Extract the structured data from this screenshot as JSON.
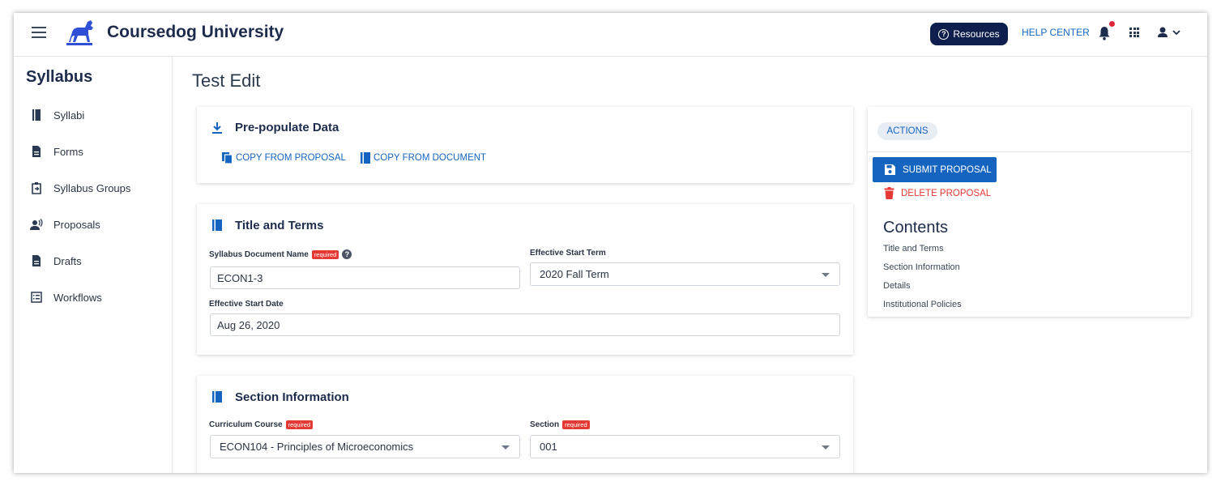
{
  "header": {
    "brand": "Coursedog University",
    "resources_label": "Resources",
    "help_center_label": "HELP CENTER"
  },
  "sidebar": {
    "title": "Syllabus",
    "items": [
      {
        "label": "Syllabi",
        "icon": "book-icon"
      },
      {
        "label": "Forms",
        "icon": "document-icon"
      },
      {
        "label": "Syllabus Groups",
        "icon": "clipboard-icon"
      },
      {
        "label": "Proposals",
        "icon": "speaker-person-icon"
      },
      {
        "label": "Drafts",
        "icon": "document-icon"
      },
      {
        "label": "Workflows",
        "icon": "list-icon"
      }
    ]
  },
  "main": {
    "page_title": "Test Edit",
    "prepopulate": {
      "title": "Pre-populate Data",
      "copy_from_proposal": "COPY FROM PROPOSAL",
      "copy_from_document": "COPY FROM DOCUMENT"
    },
    "title_terms": {
      "title": "Title and Terms",
      "doc_name_label": "Syllabus Document Name",
      "required_label": "required",
      "doc_name_value": "ECON1-3",
      "start_term_label": "Effective Start Term",
      "start_term_value": "2020 Fall Term",
      "start_date_label": "Effective Start Date",
      "start_date_value": "Aug 26, 2020"
    },
    "section_info": {
      "title": "Section Information",
      "course_label": "Curriculum Course",
      "course_value": "ECON104 - Principles of Microeconomics",
      "section_label": "Section",
      "section_value": "001",
      "required_label": "required"
    }
  },
  "panel": {
    "actions_label": "ACTIONS",
    "submit_label": "SUBMIT PROPOSAL",
    "delete_label": "DELETE PROPOSAL",
    "contents_title": "Contents",
    "contents_links": [
      "Title and Terms",
      "Section Information",
      "Details",
      "Institutional Policies"
    ]
  },
  "colors": {
    "accent": "#1565c0",
    "danger": "#e53935",
    "navy": "#0e1f4d"
  }
}
